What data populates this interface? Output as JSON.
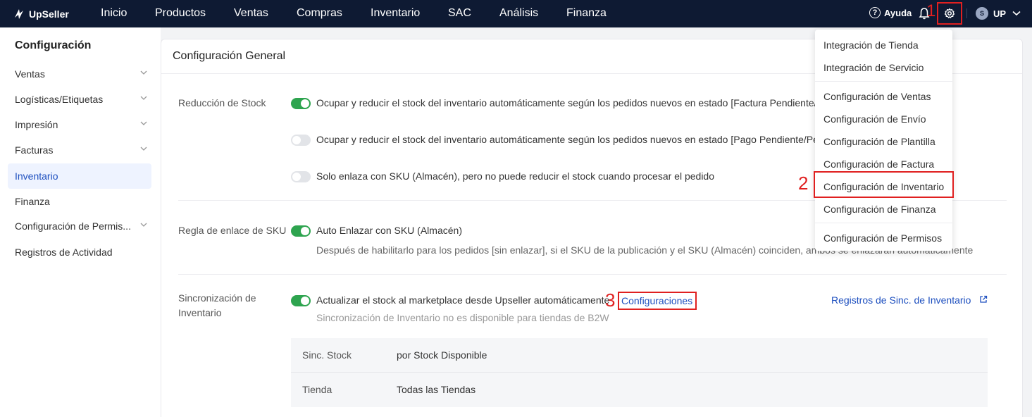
{
  "brand": {
    "name": "UpSeller"
  },
  "nav": [
    "Inicio",
    "Productos",
    "Ventas",
    "Compras",
    "Inventario",
    "SAC",
    "Análisis",
    "Finanza"
  ],
  "topright": {
    "help": "Ayuda",
    "user": "UP",
    "user_badge": "S"
  },
  "annotations": {
    "step1": "1",
    "step2": "2",
    "step3": "3"
  },
  "sidebar": {
    "title": "Configuración",
    "items": [
      {
        "label": "Ventas",
        "expandable": true
      },
      {
        "label": "Logísticas/Etiquetas",
        "expandable": true
      },
      {
        "label": "Impresión",
        "expandable": true
      },
      {
        "label": "Facturas",
        "expandable": true
      },
      {
        "label": "Inventario",
        "active": true
      },
      {
        "label": "Finanza"
      },
      {
        "label": "Configuración de Permis...",
        "expandable": true
      },
      {
        "label": "Registros de Actividad"
      }
    ]
  },
  "main": {
    "title": "Configuración General",
    "stock_reduction": {
      "label": "Reducción de Stock",
      "options": [
        {
          "text": "Ocupar y reducir el stock del inventario automáticamente según los pedidos nuevos en estado [Factura Pendiente/",
          "on": true
        },
        {
          "text": "Ocupar y reducir el stock del inventario automáticamente según los pedidos nuevos en estado [Pago Pendiente/Pe",
          "on": false
        },
        {
          "text": "Solo enlaza con SKU (Almacén), pero no puede reducir el stock cuando procesar el pedido",
          "on": false
        }
      ]
    },
    "sku_link": {
      "label": "Regla de enlace de SKU",
      "option": "Auto Enlazar con SKU (Almacén)",
      "hint": "Después de habilitarlo para los pedidos [sin enlazar], si el SKU de la publicación y el SKU (Almacén) coinciden, ambos se enlazarán automáticamente"
    },
    "sync": {
      "label_line1": "Sincronización de",
      "label_line2": "Inventario",
      "option": "Actualizar el stock al marketplace desde Upseller automáticamente",
      "config_link": "Configuraciones",
      "records_link": "Registros de Sinc. de Inventario",
      "hint": "Sincronización de Inventario no es disponible para tiendas de B2W",
      "table": [
        {
          "label": "Sinc. Stock",
          "value": "por Stock Disponible"
        },
        {
          "label": "Tienda",
          "value": "Todas las Tiendas"
        }
      ]
    }
  },
  "settings_menu": {
    "group1": [
      "Integración de Tienda",
      "Integración de Servicio"
    ],
    "group2": [
      "Configuración de Ventas",
      "Configuración de Envío",
      "Configuración de Plantilla",
      "Configuración de Factura",
      "Configuración de Inventario",
      "Configuración de Finanza"
    ],
    "group3": [
      "Configuración de Permisos"
    ]
  }
}
